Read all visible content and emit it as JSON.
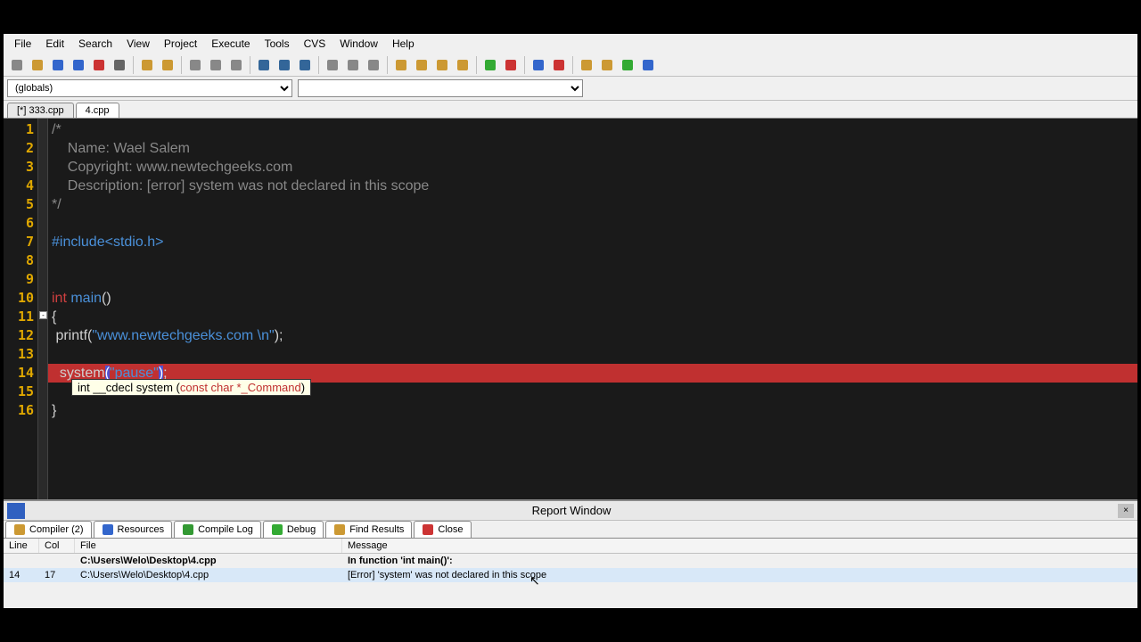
{
  "menu": [
    "File",
    "Edit",
    "Search",
    "View",
    "Project",
    "Execute",
    "Tools",
    "CVS",
    "Window",
    "Help"
  ],
  "toolbar_icons": [
    "new-file",
    "open-file",
    "save",
    "save-all",
    "save-as",
    "print",
    "sep",
    "undo",
    "redo",
    "sep",
    "find",
    "replace",
    "find-in-files",
    "sep",
    "indent",
    "outdent",
    "bookmark",
    "sep",
    "back",
    "forward",
    "stop",
    "sep",
    "grid-4",
    "split-h",
    "split-2x2",
    "split-v",
    "sep",
    "compile",
    "cancel-compile",
    "sep",
    "debug-start",
    "debug-stop",
    "sep",
    "goto-1",
    "goto-2",
    "run",
    "console"
  ],
  "scope_selector": "(globals)",
  "symbol_selector": "",
  "tabs": [
    {
      "label": "[*] 333.cpp",
      "active": false
    },
    {
      "label": "4.cpp",
      "active": true
    }
  ],
  "code_lines": [
    {
      "n": 1,
      "segs": [
        {
          "c": "grey",
          "t": "/*"
        }
      ]
    },
    {
      "n": 2,
      "segs": [
        {
          "c": "grey",
          "t": "    Name: Wael Salem"
        }
      ]
    },
    {
      "n": 3,
      "segs": [
        {
          "c": "grey",
          "t": "    Copyright: www.newtechgeeks.com"
        }
      ]
    },
    {
      "n": 4,
      "segs": [
        {
          "c": "grey",
          "t": "    Description: [error] system was not declared in this scope"
        }
      ]
    },
    {
      "n": 5,
      "segs": [
        {
          "c": "grey",
          "t": "*/"
        }
      ]
    },
    {
      "n": 6,
      "segs": []
    },
    {
      "n": 7,
      "segs": [
        {
          "c": "blue",
          "t": "#include<stdio.h>"
        }
      ]
    },
    {
      "n": 8,
      "segs": []
    },
    {
      "n": 9,
      "segs": []
    },
    {
      "n": 10,
      "segs": [
        {
          "c": "red",
          "t": "int "
        },
        {
          "c": "blue",
          "t": "main"
        },
        {
          "c": "white",
          "t": "()"
        }
      ]
    },
    {
      "n": 11,
      "segs": [
        {
          "c": "white",
          "t": "{"
        }
      ],
      "fold": "-"
    },
    {
      "n": 12,
      "segs": [
        {
          "c": "white",
          "t": " printf("
        },
        {
          "c": "blue",
          "t": "\"www.newtechgeeks.com \\n\""
        },
        {
          "c": "white",
          "t": ");"
        }
      ]
    },
    {
      "n": 13,
      "segs": []
    },
    {
      "n": 14,
      "hl": "error",
      "segs": [
        {
          "c": "white",
          "t": "  system"
        },
        {
          "c": "br",
          "t": "("
        },
        {
          "c": "blue",
          "t": "\"pause\""
        },
        {
          "c": "br",
          "t": ")"
        },
        {
          "c": "white",
          "t": ";"
        }
      ]
    },
    {
      "n": 15,
      "segs": []
    },
    {
      "n": 16,
      "segs": [
        {
          "c": "white",
          "t": "}"
        }
      ]
    }
  ],
  "tooltip": {
    "prefix": "int __cdecl system (",
    "args": "const char *_Command",
    "suffix": ")"
  },
  "report": {
    "title": "Report Window",
    "tabs": [
      {
        "icon": "compiler",
        "label": "Compiler (2)",
        "active": true
      },
      {
        "icon": "resources",
        "label": "Resources"
      },
      {
        "icon": "compile-log",
        "label": "Compile Log"
      },
      {
        "icon": "debug",
        "label": "Debug"
      },
      {
        "icon": "find-results",
        "label": "Find Results"
      },
      {
        "icon": "close",
        "label": "Close"
      }
    ],
    "headers": {
      "line": "Line",
      "col": "Col",
      "file": "File",
      "msg": "Message"
    },
    "rows": [
      {
        "line": "",
        "col": "",
        "file": "C:\\Users\\Welo\\Desktop\\4.cpp",
        "msg": "In function 'int main()':",
        "bold": true
      },
      {
        "line": "14",
        "col": "17",
        "file": "C:\\Users\\Welo\\Desktop\\4.cpp",
        "msg": "[Error] 'system' was not declared in this scope",
        "bold": false,
        "sel": true
      }
    ]
  }
}
